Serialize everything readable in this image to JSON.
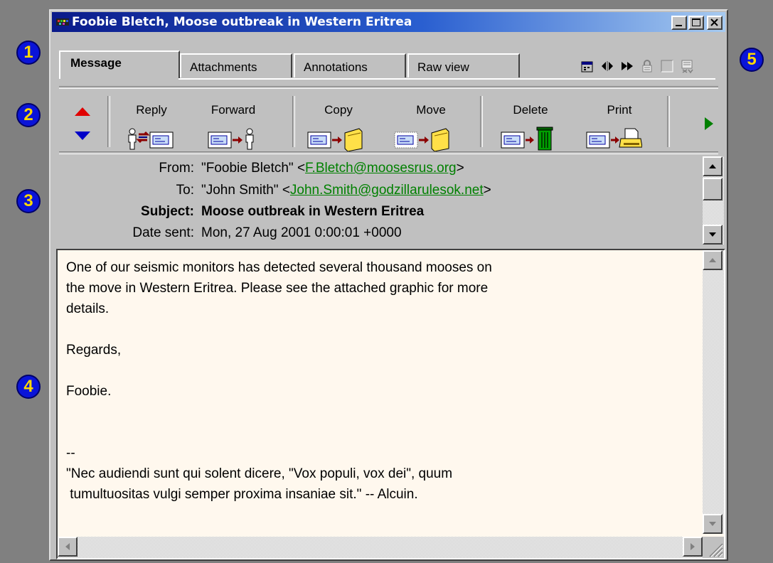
{
  "callouts": [
    "1",
    "2",
    "3",
    "4",
    "5"
  ],
  "window": {
    "title": "Foobie Bletch, Moose outbreak in Western Eritrea",
    "minimize_icon": "minimize-icon",
    "maximize_icon": "maximize-icon",
    "close_icon": "close-icon"
  },
  "tabs": [
    {
      "label": "Message",
      "active": true
    },
    {
      "label": "Attachments",
      "active": false
    },
    {
      "label": "Annotations",
      "active": false
    },
    {
      "label": "Raw view",
      "active": false
    }
  ],
  "status_icons": [
    "calendar-icon",
    "left-right-icon",
    "fast-forward-icon",
    "lock-icon",
    "checkbox-icon",
    "signature-icon"
  ],
  "toolbar": {
    "nav_up_icon": "arrow-up-icon",
    "nav_down_icon": "arrow-down-icon",
    "reply": "Reply",
    "forward": "Forward",
    "copy": "Copy",
    "move": "Move",
    "delete": "Delete",
    "print": "Print",
    "more_icon": "arrow-right-icon"
  },
  "header": {
    "from_label": "From:",
    "from_name": "\"Foobie Bletch\" <",
    "from_email": "F.Bletch@moosesrus.org",
    "from_tail": ">",
    "to_label": "To:",
    "to_name": "\"John Smith\" <",
    "to_email": "John.Smith@godzillarulesok.net",
    "to_tail": ">",
    "subject_label": "Subject:",
    "subject": "Moose outbreak in Western Eritrea",
    "date_label": "Date sent:",
    "date": "Mon, 27 Aug 2001 0:00:01 +0000"
  },
  "body": {
    "text": "One of our seismic monitors has detected several thousand mooses on\nthe move in Western Eritrea. Please see the attached graphic for more\ndetails.\n\nRegards,\n\nFoobie.\n\n\n--\n\"Nec audiendi sunt qui solent dicere, \"Vox populi, vox dei\", quum\n tumultuositas vulgi semper proxima insaniae sit.\" -- Alcuin."
  },
  "colors": {
    "title_gradient_start": "#0a1a8a",
    "title_gradient_end": "#a6caf0",
    "email_link": "#008000",
    "body_background": "#fff8ee",
    "callout_fill": "#0a14d8",
    "callout_text": "#ffd800"
  }
}
